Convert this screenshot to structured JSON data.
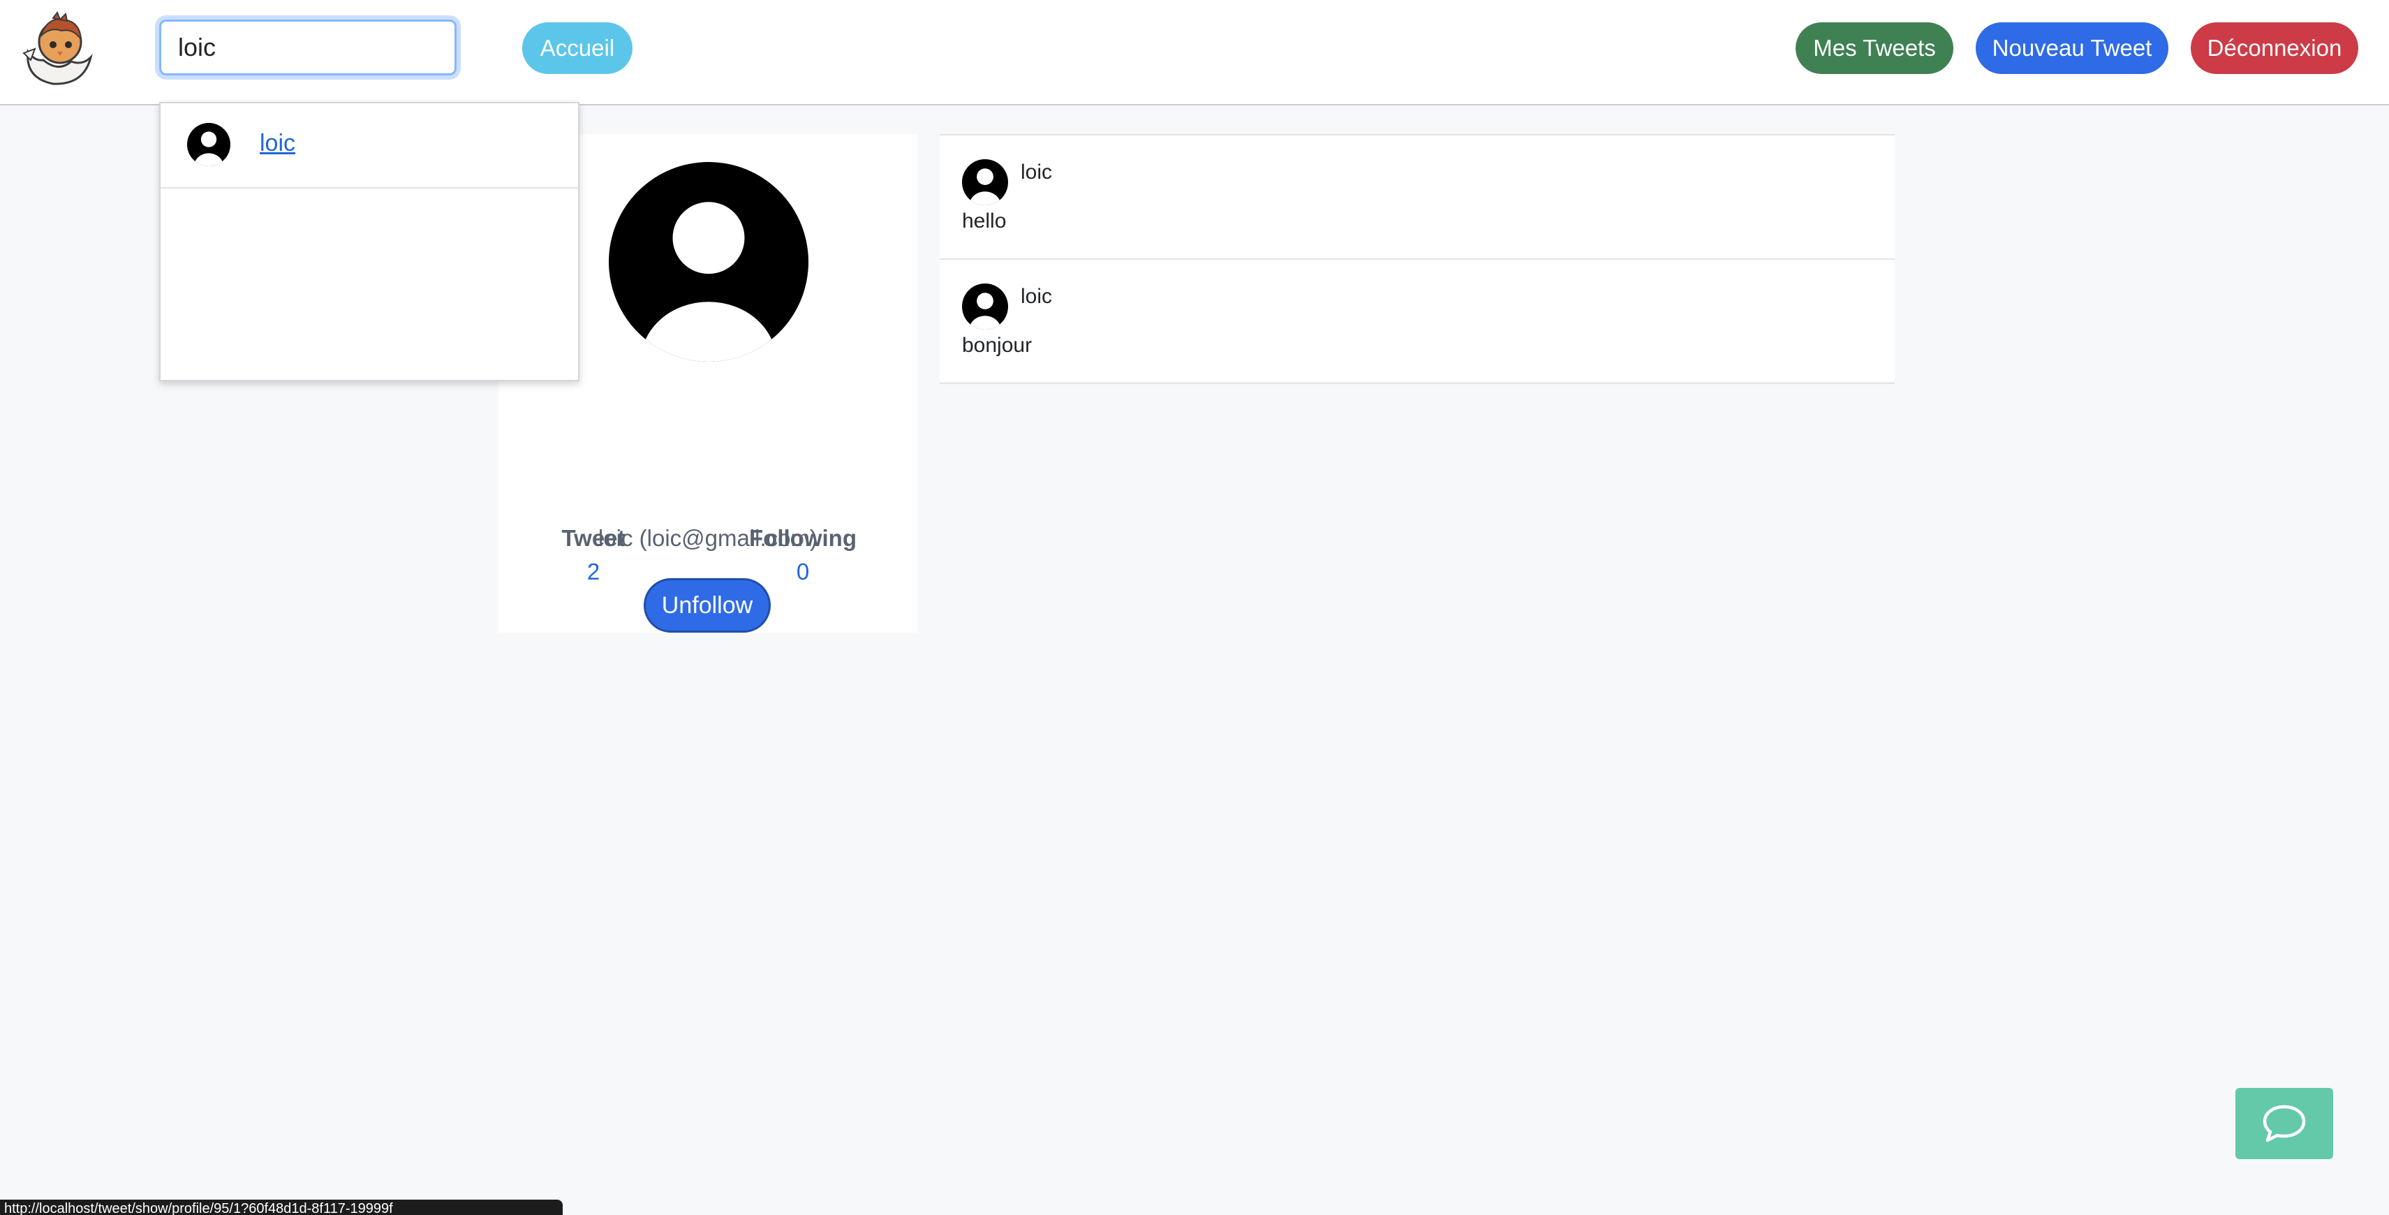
{
  "header": {
    "logo_icon": "chick-in-egg-logo",
    "search": {
      "value": "loic",
      "placeholder": ""
    },
    "home_label": "Accueil",
    "my_tweets_label": "Mes Tweets",
    "new_tweet_label": "Nouveau Tweet",
    "logout_label": "Déconnexion"
  },
  "search_results": [
    {
      "name": "loic",
      "icon": "user-avatar-icon"
    }
  ],
  "profile": {
    "identity": "loic (loic@gmail.com)",
    "action_label": "Unfollow",
    "stats": [
      {
        "label": "Tweet",
        "value": "2"
      },
      {
        "label": "Following",
        "value": "0"
      }
    ]
  },
  "tweets": [
    {
      "author": "loic",
      "text": "hello"
    },
    {
      "author": "loic",
      "text": "bonjour"
    }
  ],
  "chat": {
    "icon": "chat-bubble-icon"
  },
  "status_bar": {
    "url": "http://localhost/tweet/show/profile/95/1?60f48d1d-8f117-19999f"
  },
  "colors": {
    "home": "#5bc6ea",
    "my_tweets": "#3f8153",
    "new_tweet": "#2f6be6",
    "logout": "#cd3b47",
    "chat": "#63c9a8",
    "link": "#2266d9"
  }
}
